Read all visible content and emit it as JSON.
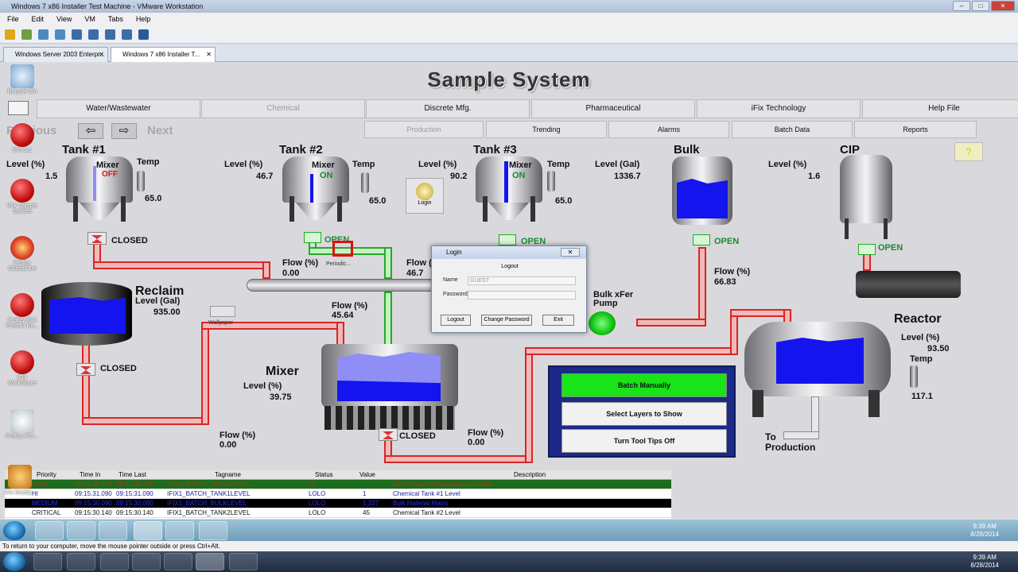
{
  "window": {
    "title": "Windows 7 x86 Installer Test Machine - VMware Workstation",
    "menu": [
      "File",
      "Edit",
      "View",
      "VM",
      "Tabs",
      "Help"
    ],
    "tabs": [
      {
        "label": "Windows Server 2003 Enterpr..."
      },
      {
        "label": "Windows 7 x86 Installer T..."
      }
    ],
    "status_text": "To return to your computer, move the mouse pointer outside or press Ctrl+Alt."
  },
  "desktop": {
    "icons": [
      {
        "label": "Recycle Bin"
      },
      {
        "label": "iFIX 5.1"
      },
      {
        "label": "iFIX Sample System"
      },
      {
        "label": "Proficy GlobalCare"
      },
      {
        "label": "Proficy iFIX Product Re..."
      },
      {
        "label": "iFIX WorkSpace"
      },
      {
        "label": "Proficy iFIX..."
      },
      {
        "label": "iFix Moddy"
      }
    ]
  },
  "scada": {
    "title": "Sample System",
    "top_nav": [
      "Water/Wastewater",
      "Chemical",
      "Discrete Mfg.",
      "Pharmaceutical",
      "iFix Technology",
      "Help File"
    ],
    "sub_nav": [
      "Production",
      "Trending",
      "Alarms",
      "Batch Data",
      "Reports"
    ],
    "previous_label": "Previous",
    "next_label": "Next",
    "tank1": {
      "name": "Tank #1",
      "level_label": "Level (%)",
      "level": "1.5",
      "mixer_label": "Mixer",
      "mixer_state": "OFF",
      "temp_label": "Temp",
      "temp": "65.0",
      "valve": "CLOSED"
    },
    "tank2": {
      "name": "Tank #2",
      "level_label": "Level (%)",
      "level": "46.7",
      "mixer_label": "Mixer",
      "mixer_state": "ON",
      "temp_label": "Temp",
      "temp": "65.0",
      "valve": "OPEN"
    },
    "tank3": {
      "name": "Tank #3",
      "level_label": "Level (%)",
      "level": "90.2",
      "mixer_label": "Mixer",
      "mixer_state": "ON",
      "temp_label": "Temp",
      "temp": "65.0",
      "valve": "OPEN"
    },
    "bulk": {
      "name": "Bulk",
      "level_label": "Level (Gal)",
      "level": "1336.7",
      "valve": "OPEN"
    },
    "cip": {
      "name": "CIP",
      "level_label": "Level (%)",
      "level": "1.6",
      "valve": "OPEN"
    },
    "reclaim": {
      "name": "Reclaim",
      "level_label": "Level (Gal)",
      "level": "935.00",
      "valve": "CLOSED"
    },
    "mixer": {
      "name": "Mixer",
      "level_label": "Level (%)",
      "level": "39.75",
      "valve": "CLOSED"
    },
    "reactor": {
      "name": "Reactor",
      "level_label": "Level (%)",
      "level": "93.50",
      "temp_label": "Temp",
      "temp": "117.1"
    },
    "flows": {
      "flow_label": "Flow (%)",
      "f1": "0.00",
      "f2": "46.7",
      "f3": "45.64",
      "f4": "66.83",
      "f5": "0.00",
      "f6": "0.00"
    },
    "pump_label": "Bulk xFer\nPump",
    "to_production": "To\nProduction",
    "login_icon_label": "Login",
    "periodic_label": "Periodic...",
    "wallpaper_label": "Wallpaper",
    "batch_buttons": [
      "Batch Manually",
      "Select Layers to Show",
      "Turn Tool Tips Off"
    ],
    "question": "?"
  },
  "login_dialog": {
    "title": "Login",
    "subtitle": "Logout",
    "name_label": "Name",
    "name_value": "GUEST",
    "password_label": "Password",
    "buttons": [
      "Logout",
      "Change Password",
      "Exit"
    ]
  },
  "alarms": {
    "headers": [
      "Priority",
      "Time In",
      "Time Last",
      "Tagname",
      "Status",
      "Value",
      "Description"
    ],
    "rows": [
      {
        "priority": "HIGH",
        "time_in": "09:15:30.740",
        "time_last": "09:15:30.740",
        "tag": "IFIX1_BATCH_TANK3LEVEL",
        "status": "HI",
        "value": "",
        "desc": "Batch Tank #3 Temperature Control",
        "color": "#1d6b1d",
        "text": "#a23a16"
      },
      {
        "priority": "HI",
        "time_in": "09:15:31.090",
        "time_last": "09:15:31.090",
        "tag": "IFIX1_BATCH_TANK1LEVEL",
        "status": "LOLO",
        "value": "1",
        "desc": "Chemical Tank #1 Level",
        "color": "#ffffff",
        "text": "#1a1aa8"
      },
      {
        "priority": "MEDIUM",
        "time_in": "09:15:30.090",
        "time_last": "09:15:30.090",
        "tag": "IFIX1_BATCH_BULKLEVEL",
        "status": "LOLO",
        "value": "1,337",
        "desc": "Bulk Material Mains",
        "color": "#000000",
        "text": "#2a2aff"
      },
      {
        "priority": "CRITICAL",
        "time_in": "09:15:30.140",
        "time_last": "09:15:30.140",
        "tag": "IFIX1_BATCH_TANK2LEVEL",
        "status": "LOLO",
        "value": "45",
        "desc": "Chemical Tank #2 Level",
        "color": "#ffffff",
        "text": "#111111"
      }
    ]
  },
  "guest_taskbar": {
    "time": "9:39 AM",
    "date": "8/28/2014"
  },
  "host_taskbar": {
    "time": "9:39 AM",
    "date": "8/28/2014"
  }
}
